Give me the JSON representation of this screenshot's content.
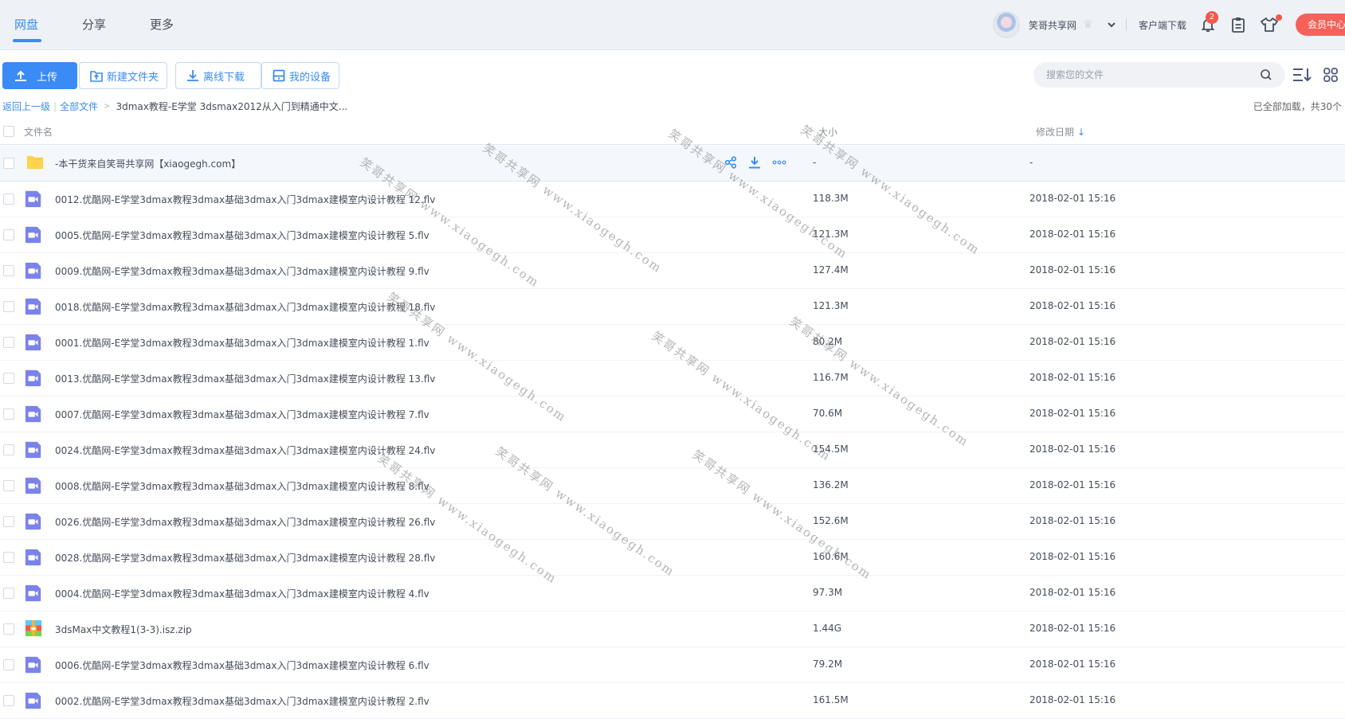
{
  "topbar": {
    "tabs": [
      {
        "label": "网盘",
        "active": true
      },
      {
        "label": "分享",
        "active": false
      },
      {
        "label": "更多",
        "active": false
      }
    ],
    "username": "笑哥共享网",
    "client_download": "客户端下载",
    "notification_count": "2",
    "vip_center": "会员中心"
  },
  "toolbar": {
    "upload": "上传",
    "new_folder": "新建文件夹",
    "offline_download": "离线下载",
    "my_devices": "我的设备",
    "search_placeholder": "搜索您的文件"
  },
  "breadcrumb": {
    "back": "返回上一级",
    "all_files": "全部文件",
    "current": "3dmax教程-E学堂 3dsmax2012从入门到精通中文..."
  },
  "status": "已全部加载，共30个",
  "table": {
    "headers": {
      "name": "文件名",
      "size": "大小",
      "date": "修改日期"
    },
    "rows": [
      {
        "type": "folder",
        "name": "-本干货来自笑哥共享网【xiaogegh.com】",
        "size": "-",
        "date": "-"
      },
      {
        "type": "video",
        "name": "0012.优酷网-E学堂3dmax教程3dmax基础3dmax入门3dmax建模室内设计教程 12.flv",
        "size": "118.3M",
        "date": "2018-02-01 15:16"
      },
      {
        "type": "video",
        "name": "0005.优酷网-E学堂3dmax教程3dmax基础3dmax入门3dmax建模室内设计教程 5.flv",
        "size": "121.3M",
        "date": "2018-02-01 15:16"
      },
      {
        "type": "video",
        "name": "0009.优酷网-E学堂3dmax教程3dmax基础3dmax入门3dmax建模室内设计教程 9.flv",
        "size": "127.4M",
        "date": "2018-02-01 15:16"
      },
      {
        "type": "video",
        "name": "0018.优酷网-E学堂3dmax教程3dmax基础3dmax入门3dmax建模室内设计教程 18.flv",
        "size": "121.3M",
        "date": "2018-02-01 15:16"
      },
      {
        "type": "video",
        "name": "0001.优酷网-E学堂3dmax教程3dmax基础3dmax入门3dmax建模室内设计教程 1.flv",
        "size": "80.2M",
        "date": "2018-02-01 15:16"
      },
      {
        "type": "video",
        "name": "0013.优酷网-E学堂3dmax教程3dmax基础3dmax入门3dmax建模室内设计教程 13.flv",
        "size": "116.7M",
        "date": "2018-02-01 15:16"
      },
      {
        "type": "video",
        "name": "0007.优酷网-E学堂3dmax教程3dmax基础3dmax入门3dmax建模室内设计教程 7.flv",
        "size": "70.6M",
        "date": "2018-02-01 15:16"
      },
      {
        "type": "video",
        "name": "0024.优酷网-E学堂3dmax教程3dmax基础3dmax入门3dmax建模室内设计教程 24.flv",
        "size": "154.5M",
        "date": "2018-02-01 15:16"
      },
      {
        "type": "video",
        "name": "0008.优酷网-E学堂3dmax教程3dmax基础3dmax入门3dmax建模室内设计教程 8.flv",
        "size": "136.2M",
        "date": "2018-02-01 15:16"
      },
      {
        "type": "video",
        "name": "0026.优酷网-E学堂3dmax教程3dmax基础3dmax入门3dmax建模室内设计教程 26.flv",
        "size": "152.6M",
        "date": "2018-02-01 15:16"
      },
      {
        "type": "video",
        "name": "0028.优酷网-E学堂3dmax教程3dmax基础3dmax入门3dmax建模室内设计教程 28.flv",
        "size": "160.6M",
        "date": "2018-02-01 15:16"
      },
      {
        "type": "video",
        "name": "0004.优酷网-E学堂3dmax教程3dmax基础3dmax入门3dmax建模室内设计教程 4.flv",
        "size": "97.3M",
        "date": "2018-02-01 15:16"
      },
      {
        "type": "zip",
        "name": "3dsMax中文教程1(3-3).isz.zip",
        "size": "1.44G",
        "date": "2018-02-01 15:16"
      },
      {
        "type": "video",
        "name": "0006.优酷网-E学堂3dmax教程3dmax基础3dmax入门3dmax建模室内设计教程 6.flv",
        "size": "79.2M",
        "date": "2018-02-01 15:16"
      },
      {
        "type": "video",
        "name": "0002.优酷网-E学堂3dmax教程3dmax基础3dmax入门3dmax建模室内设计教程 2.flv",
        "size": "161.5M",
        "date": "2018-02-01 15:16"
      }
    ]
  },
  "watermark": "笑哥共享网 www.xiaogegh.com",
  "colors": {
    "accent": "#3a8bf5",
    "vip": "#f6615a",
    "badge": "#f5574a",
    "video_icon": "#7b83eb",
    "folder_icon": "#ffd34e"
  }
}
